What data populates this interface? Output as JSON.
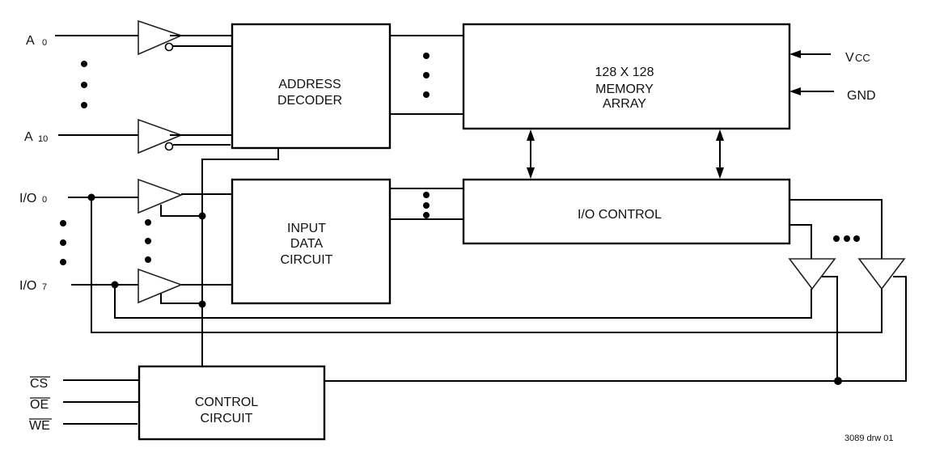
{
  "diagram": {
    "drawing_id": "3089 drw 01",
    "blocks": {
      "address_decoder": [
        "ADDRESS",
        "DECODER"
      ],
      "memory_array": [
        "128 X 128",
        "MEMORY",
        "ARRAY"
      ],
      "input_data_circuit": [
        "INPUT",
        "DATA",
        "CIRCUIT"
      ],
      "io_control": [
        "I/O CONTROL"
      ],
      "control_circuit": [
        "CONTROL",
        "CIRCUIT"
      ]
    },
    "address_inputs": [
      {
        "base": "A",
        "sub": "0"
      },
      {
        "base": "A",
        "sub": "10"
      }
    ],
    "io_pins": [
      {
        "base": "I/O",
        "sub": "0"
      },
      {
        "base": "I/O",
        "sub": "7"
      }
    ],
    "control_inputs": [
      "CS",
      "OE",
      "WE"
    ],
    "power": {
      "vcc": {
        "base": "V",
        "sub": "CC"
      },
      "gnd": "GND"
    }
  }
}
